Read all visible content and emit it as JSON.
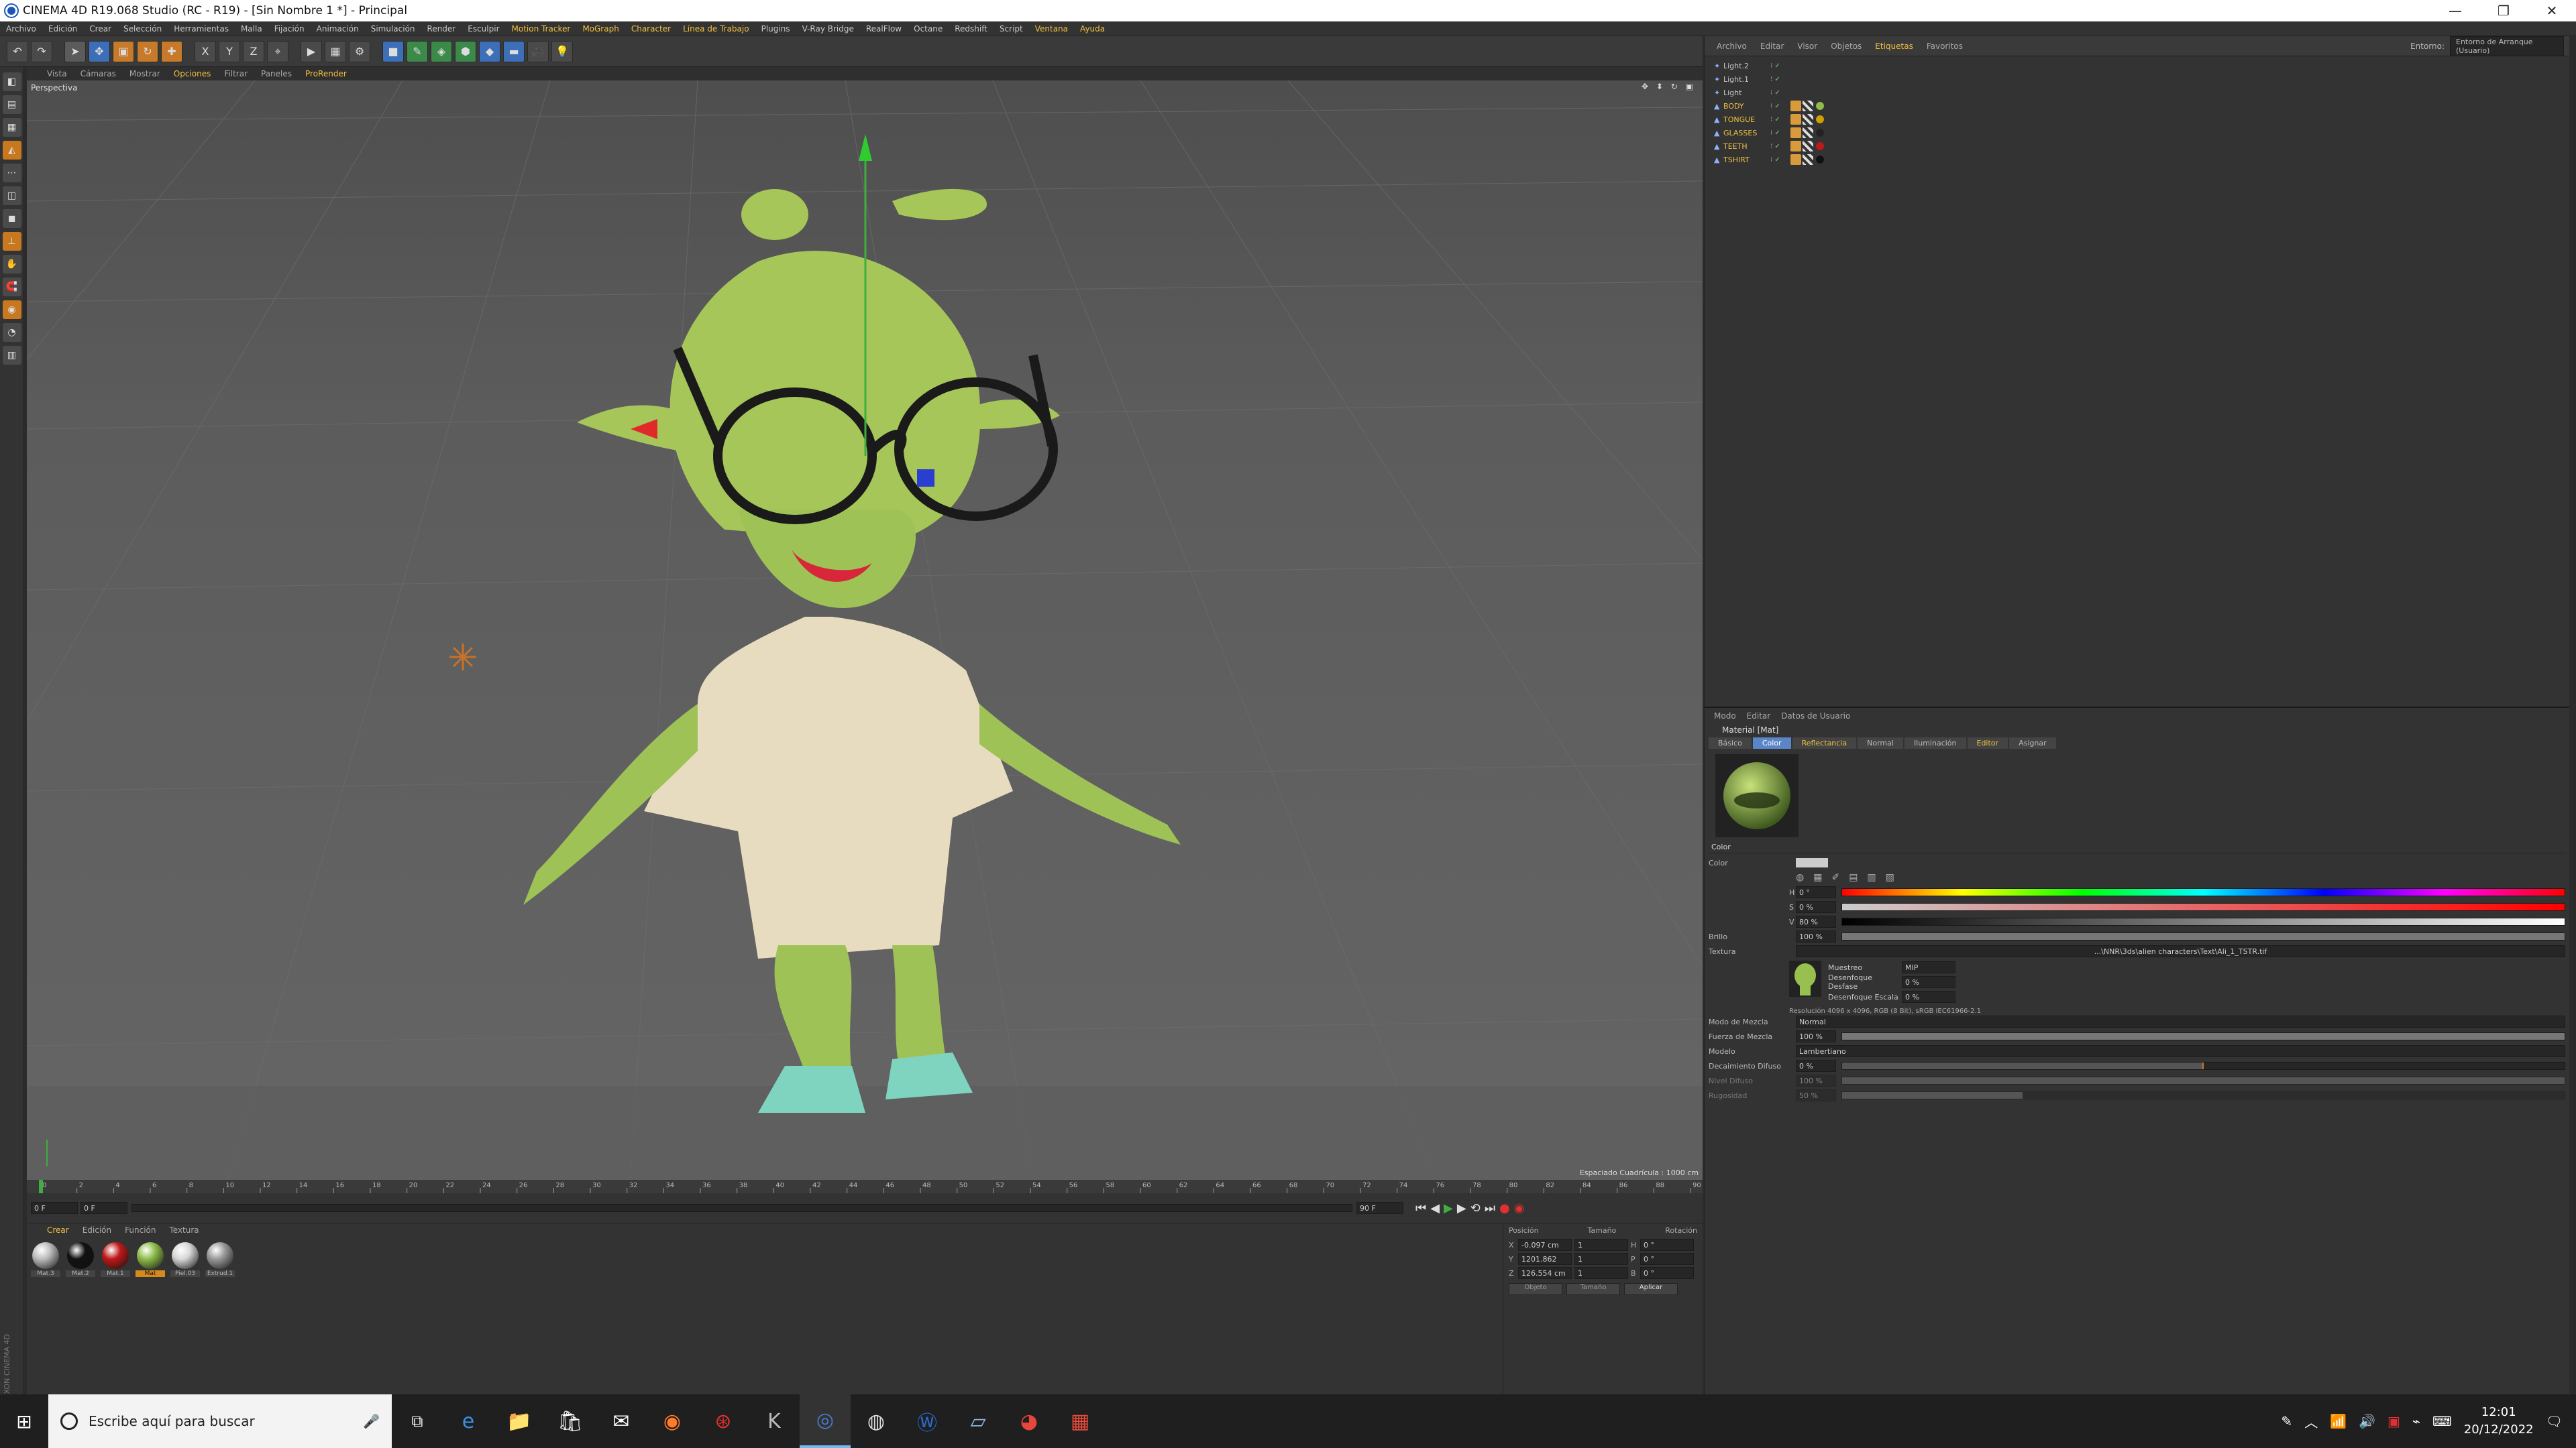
{
  "window": {
    "title": "CINEMA 4D R19.068 Studio (RC - R19) - [Sin Nombre 1 *] - Principal",
    "minimize": "—",
    "maximize": "❐",
    "close": "✕"
  },
  "menubar": [
    "Archivo",
    "Edición",
    "Crear",
    "Selección",
    "Herramientas",
    "Malla",
    "Fijación",
    "Animación",
    "Simulación",
    "Render",
    "Esculpir",
    "Motion Tracker",
    "MoGraph",
    "Character",
    "Línea de Trabajo",
    "Plugins",
    "V-Ray Bridge",
    "RealFlow",
    "Octane",
    "Redshift",
    "Script",
    "Ventana",
    "Ayuda"
  ],
  "menubar_highlight": [
    "Motion Tracker",
    "MoGraph",
    "Character",
    "Línea de Trabajo",
    "Ventana",
    "Ayuda"
  ],
  "viewport": {
    "menu": [
      "Vista",
      "Cámaras",
      "Mostrar",
      "Opciones",
      "Filtrar",
      "Paneles",
      "ProRender"
    ],
    "label": "Perspectiva",
    "grid_info": "Espaciado Cuadrícula : 1000 cm"
  },
  "timeline": {
    "ticks": [
      "0",
      "2",
      "4",
      "6",
      "8",
      "10",
      "12",
      "14",
      "16",
      "18",
      "20",
      "22",
      "24",
      "26",
      "28",
      "30",
      "32",
      "34",
      "36",
      "38",
      "40",
      "42",
      "44",
      "46",
      "48",
      "50",
      "52",
      "54",
      "56",
      "58",
      "60",
      "62",
      "64",
      "66",
      "68",
      "70",
      "72",
      "74",
      "76",
      "78",
      "80",
      "82",
      "84",
      "86",
      "88",
      "90"
    ],
    "current_frame": "0 F",
    "start_frame": "0 F",
    "end_frame": "90 F",
    "frame_end_right": "0 F"
  },
  "materials": {
    "menu": [
      "Crear",
      "Edición",
      "Función",
      "Textura"
    ],
    "items": [
      {
        "name": "Mat.3",
        "color": "#bdbdbd",
        "selected": false
      },
      {
        "name": "Mat.2",
        "color": "#111111",
        "selected": false
      },
      {
        "name": "Mat.1",
        "color": "#c01818",
        "selected": false
      },
      {
        "name": "Mat",
        "color": "#8fbe4a",
        "selected": true
      },
      {
        "name": "Piel.03",
        "color": "#d8d8d8",
        "selected": false
      },
      {
        "name": "Extrud.1",
        "color": "#9a9a9a",
        "selected": false
      }
    ]
  },
  "coords": {
    "headers": [
      "Posición",
      "Tamaño",
      "Rotación"
    ],
    "rows": [
      {
        "axis": "X",
        "pos": "-0.097 cm",
        "size": "1",
        "rot_axis": "H",
        "rot": "0 °"
      },
      {
        "axis": "Y",
        "pos": "1201.862 cm",
        "size": "1",
        "rot_axis": "P",
        "rot": "0 °"
      },
      {
        "axis": "Z",
        "pos": "126.554 cm",
        "size": "1",
        "rot_axis": "B",
        "rot": "0 °"
      }
    ],
    "mode1": "Objeto",
    "mode2": "Tamaño",
    "apply": "Aplicar"
  },
  "object_manager": {
    "tabs": [
      "Archivo",
      "Editar",
      "Visor",
      "Objetos",
      "Etiquetas",
      "Favoritos"
    ],
    "layout_label": "Entorno:",
    "layout_value": "Entorno de Arranque (Usuario)",
    "objects": [
      {
        "name": "Light.2",
        "selected": false
      },
      {
        "name": "Light.1",
        "selected": false
      },
      {
        "name": "Light",
        "selected": false
      },
      {
        "name": "BODY",
        "selected": true
      },
      {
        "name": "TONGUE",
        "selected": true
      },
      {
        "name": "GLASSES",
        "selected": true
      },
      {
        "name": "TEETH",
        "selected": true
      },
      {
        "name": "TSHIRT",
        "selected": true
      }
    ]
  },
  "attributes": {
    "menu": [
      "Modo",
      "Editar",
      "Datos de Usuario"
    ],
    "title": "Material [Mat]",
    "tabs": [
      "Básico",
      "Color",
      "Reflectancia",
      "Normal",
      "Iluminación",
      "Editor",
      "Asignar"
    ],
    "active_tab": "Color",
    "section": "Color",
    "color_label": "Color",
    "h_label": "H",
    "h_value": "0 °",
    "s_label": "S",
    "s_value": "0 %",
    "v_label": "V",
    "v_value": "80 %",
    "brightness_label": "Brillo",
    "brightness_value": "100 %",
    "texture_label": "Textura",
    "texture_path": "...\\NNR\\3ds\\alien characters\\Text\\Ali_1_TSTR.tif",
    "sampling_label": "Muestreo",
    "sampling_value": "MIP",
    "blur_offset_label": "Desenfoque Desfase",
    "blur_offset_value": "0 %",
    "blur_scale_label": "Desenfoque Escala",
    "blur_scale_value": "0 %",
    "resolution": "Resolución 4096 x 4096, RGB (8 Bit), sRGB IEC61966-2.1",
    "mix_mode_label": "Modo de Mezcla",
    "mix_mode_value": "Normal",
    "mix_strength_label": "Fuerza de Mezcla",
    "mix_strength_value": "100 %",
    "model_label": "Modelo",
    "model_value": "Lambertiano",
    "diffuse_falloff_label": "Decaimiento Difuso",
    "diffuse_falloff_value": "0 %",
    "diffuse_level_label": "Nivel Difuso",
    "diffuse_level_value": "100 %",
    "roughness_label": "Rugosidad",
    "roughness_value": "50 %"
  },
  "taskbar": {
    "search_placeholder": "Escribe aquí para buscar",
    "time": "12:01",
    "date": "20/12/2022"
  }
}
